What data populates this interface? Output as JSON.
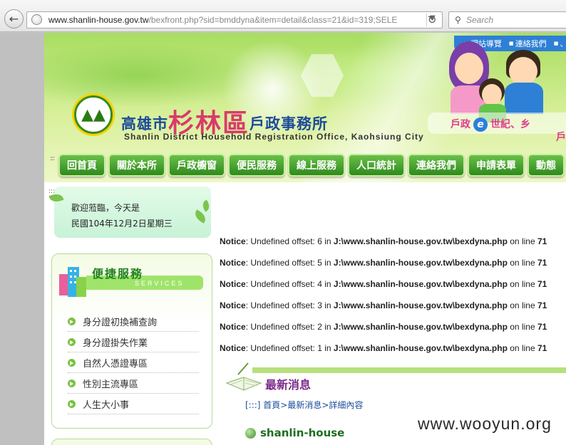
{
  "browser": {
    "url_domain": "www.shanlin-house.gov.tw",
    "url_rest": "/bexfront.php?sid=bmddyna&item=detail&class=21&id=319;SELE",
    "search_placeholder": "Search"
  },
  "header": {
    "top_links": [
      "網站導覽",
      "連絡我們",
      "、"
    ],
    "title_prefix": "高雄市",
    "title_main": "杉林區",
    "title_suffix": "戶政事務所",
    "subtitle": "Shanlin District Household Registration Office, Kaohsiung City",
    "slogan_left": "戶政",
    "slogan_e": "e",
    "slogan_right": "世紀、乡",
    "slogan_line2": "戶"
  },
  "nav": {
    "dots": ":::",
    "items": [
      "回首頁",
      "關於本所",
      "戶政櫥窗",
      "便民服務",
      "線上服務",
      "人口統計",
      "連絡我們",
      "申請表單",
      "動態"
    ]
  },
  "welcome": {
    "dots": ":::",
    "line1": "歡迎蒞臨，今天是",
    "line2": "民國104年12月2日星期三"
  },
  "services": {
    "title": "便捷服務",
    "subtitle": "SERVICES",
    "items": [
      "身分證初換補查詢",
      "身分證掛失作業",
      "自然人憑證專區",
      "性別主流專區",
      "人生大小事"
    ]
  },
  "notices": [
    {
      "label": "Notice",
      "msg": ": Undefined offset: 6 in ",
      "path": "J:\\www.shanlin-house.gov.tw\\bexdyna.php",
      "online": " on line ",
      "line": "71"
    },
    {
      "label": "Notice",
      "msg": ": Undefined offset: 5 in ",
      "path": "J:\\www.shanlin-house.gov.tw\\bexdyna.php",
      "online": " on line ",
      "line": "71"
    },
    {
      "label": "Notice",
      "msg": ": Undefined offset: 4 in ",
      "path": "J:\\www.shanlin-house.gov.tw\\bexdyna.php",
      "online": " on line ",
      "line": "71"
    },
    {
      "label": "Notice",
      "msg": ": Undefined offset: 3 in ",
      "path": "J:\\www.shanlin-house.gov.tw\\bexdyna.php",
      "online": " on line ",
      "line": "71"
    },
    {
      "label": "Notice",
      "msg": ": Undefined offset: 2 in ",
      "path": "J:\\www.shanlin-house.gov.tw\\bexdyna.php",
      "online": " on line ",
      "line": "71"
    },
    {
      "label": "Notice",
      "msg": ": Undefined offset: 1 in ",
      "path": "J:\\www.shanlin-house.gov.tw\\bexdyna.php",
      "online": " on line ",
      "line": "71"
    }
  ],
  "news": {
    "title": "最新消息",
    "breadcrumb": "[:::] 首頁>最新消息>詳細內容",
    "post_title": "shanlin-house"
  },
  "watermark": "www.wooyun.org"
}
